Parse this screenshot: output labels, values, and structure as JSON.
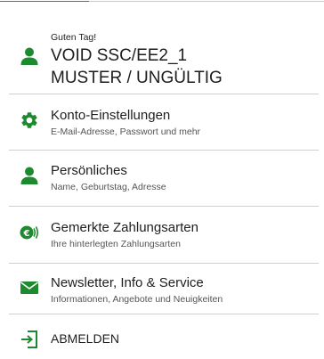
{
  "colors": {
    "accent": "#1e8a2f",
    "divider": "#cfcfcf"
  },
  "profile": {
    "greeting": "Guten Tag!",
    "name_line1": "VOID SSC/EE2_1",
    "name_line2": "MUSTER / UNGÜLTIG",
    "icon": "user-icon"
  },
  "menu": {
    "items": [
      {
        "title": "Konto-Einstellungen",
        "subtitle": "E-Mail-Adresse, Passwort und mehr",
        "icon": "gear-icon"
      },
      {
        "title": "Persönliches",
        "subtitle": "Name, Geburtstag, Adresse",
        "icon": "user-icon"
      },
      {
        "title": "Gemerkte Zahlungsarten",
        "subtitle": "Ihre hinterlegten Zahlungsarten",
        "icon": "euro-contactless-icon"
      },
      {
        "title": "Newsletter, Info & Service",
        "subtitle": "Informationen, Angebote und Neuigkeiten",
        "icon": "envelope-icon"
      }
    ],
    "logout_label": "ABMELDEN",
    "logout_icon": "logout-icon"
  }
}
